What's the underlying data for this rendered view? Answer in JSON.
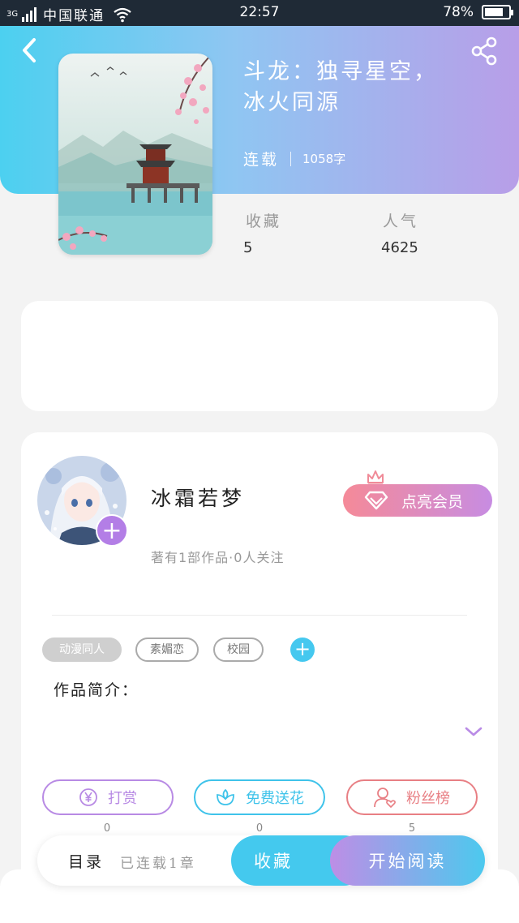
{
  "status_bar": {
    "network": "3G",
    "carrier": "中国联通",
    "time": "22:57",
    "battery_percent": "78%",
    "battery_level": 0.78
  },
  "book": {
    "title_line1": "斗龙：独寻星空，",
    "title_line2": "冰火同源",
    "status": "连载",
    "word_count": "1058字",
    "cover_image": "painting of a pavilion on a lake with cherry blossoms and birds"
  },
  "stats": {
    "collect_label": "收藏",
    "collect_value": "5",
    "popularity_label": "人气",
    "popularity_value": "4625"
  },
  "author": {
    "name": "冰霜若梦",
    "info": "著有1部作品·0人关注",
    "avatar_image": "anime girl with white hair and snowflakes",
    "vip_label": "点亮会员"
  },
  "tags": [
    "动漫同人",
    "素媚恋",
    "校园"
  ],
  "intro_label": "作品简介：",
  "actions": [
    {
      "label": "打赏",
      "count": "0",
      "icon": "yen-coin-icon",
      "color": "#b88ae4"
    },
    {
      "label": "免费送花",
      "count": "0",
      "icon": "flower-icon",
      "color": "#3fc3ea"
    },
    {
      "label": "粉丝榜",
      "count": "5",
      "icon": "fan-user-heart-icon",
      "color": "#e87f84"
    }
  ],
  "bottom_bar": {
    "toc_label": "目录",
    "toc_progress": "已连载1章",
    "collect_button": "收藏",
    "read_button": "开始阅读"
  },
  "colors": {
    "header_gradient_start": "#4cd0f0",
    "header_gradient_end": "#b89ee8",
    "accent_blue": "#44c9ee",
    "accent_purple": "#b37ee6",
    "vip_pink": "#f58a98"
  }
}
